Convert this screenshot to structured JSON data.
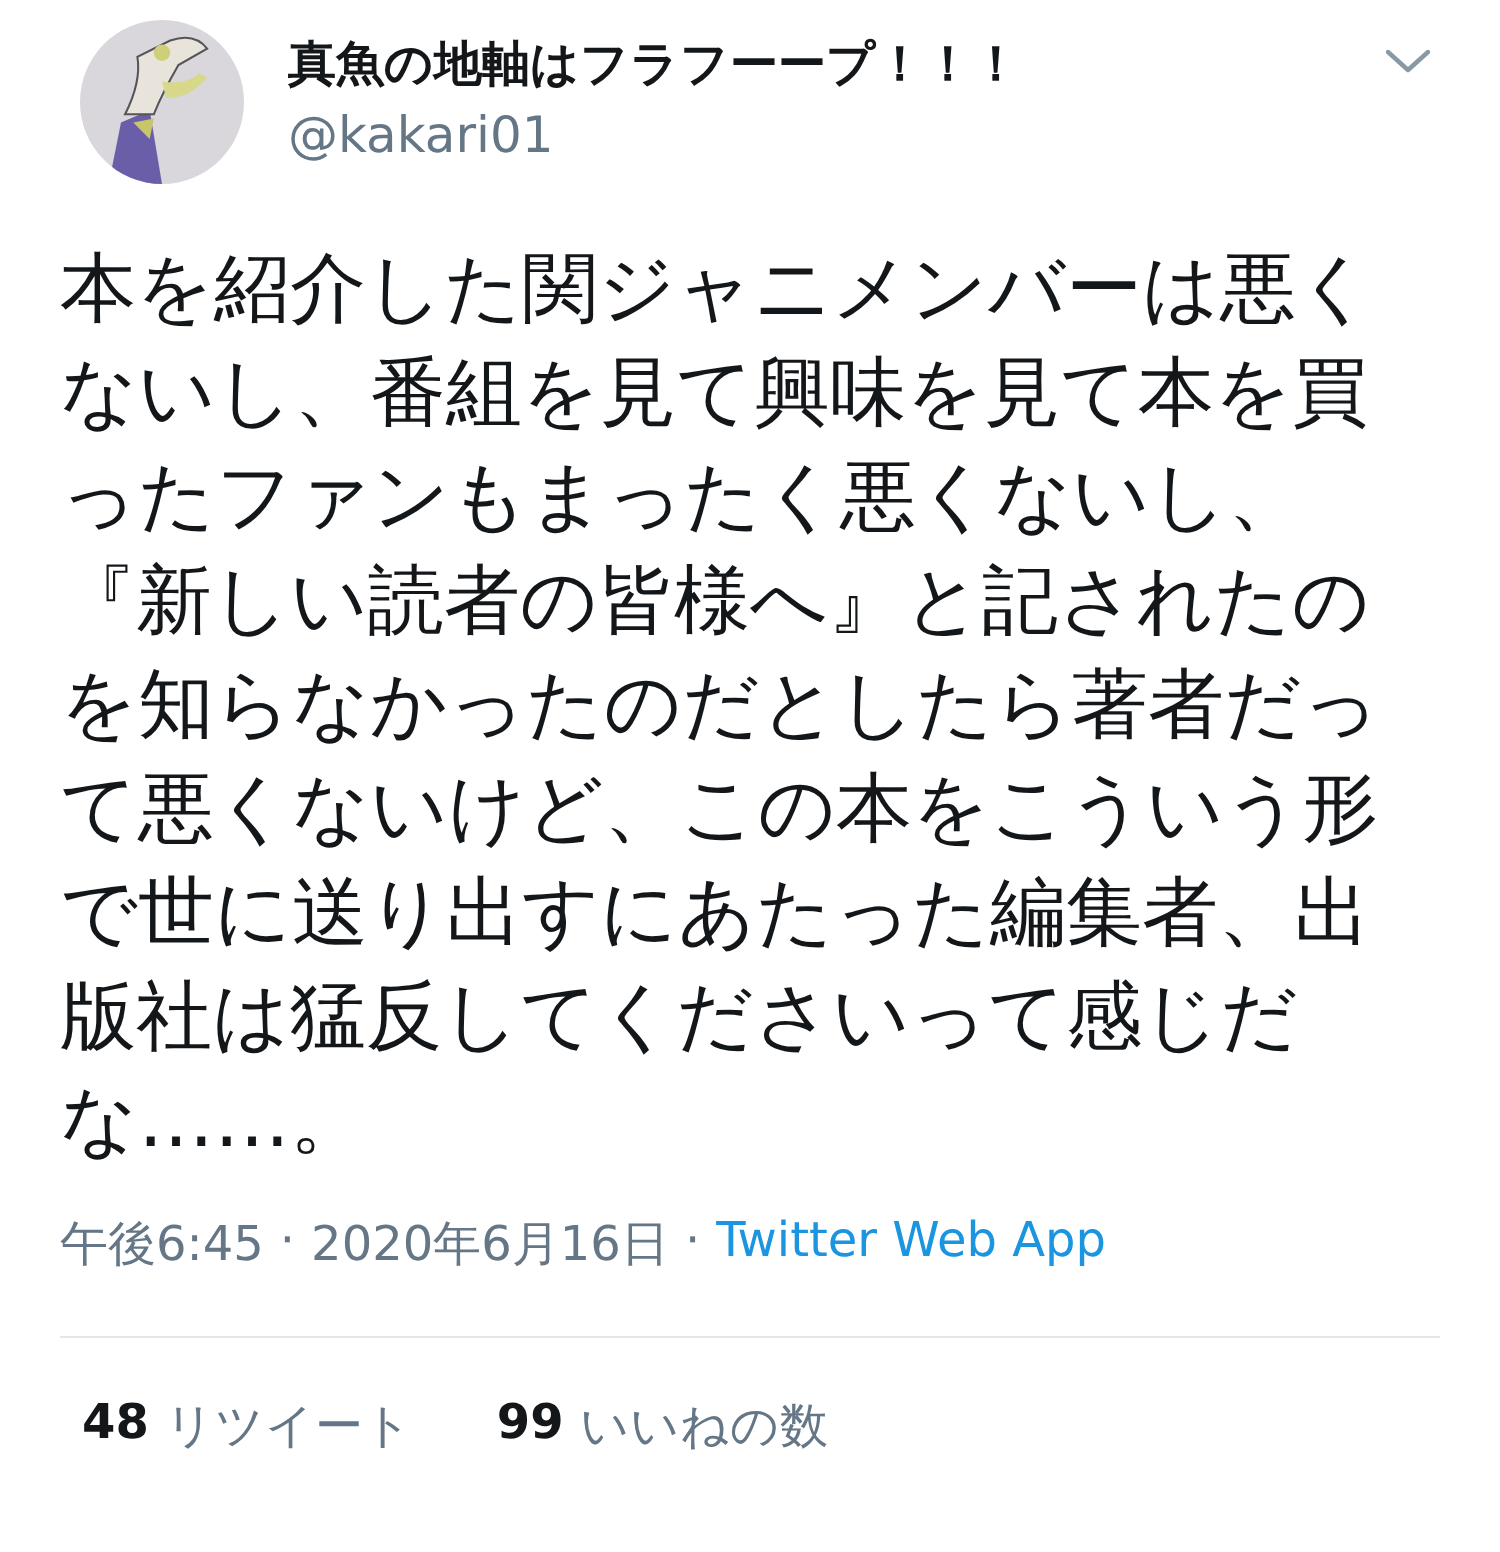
{
  "author": {
    "name": "真魚の地軸はフラフーープ！！！",
    "handle": "@kakari01"
  },
  "tweet": {
    "text": "本を紹介した関ジャニメンバーは悪くないし、番組を見て興味を見て本を買ったファンもまったく悪くないし、『新しい読者の皆様へ』と記されたのを知らなかったのだとしたら著者だって悪くないけど、この本をこういう形で世に送り出すにあたった編集者、出版社は猛反してくださいって感じだな……。"
  },
  "meta": {
    "time": "午後6:45",
    "separator": "·",
    "date": "2020年6月16日",
    "separator_2": "·",
    "source": "Twitter Web App"
  },
  "stats": [
    {
      "count": "48",
      "label": "リツイート"
    },
    {
      "count": "99",
      "label": "いいねの数"
    }
  ]
}
